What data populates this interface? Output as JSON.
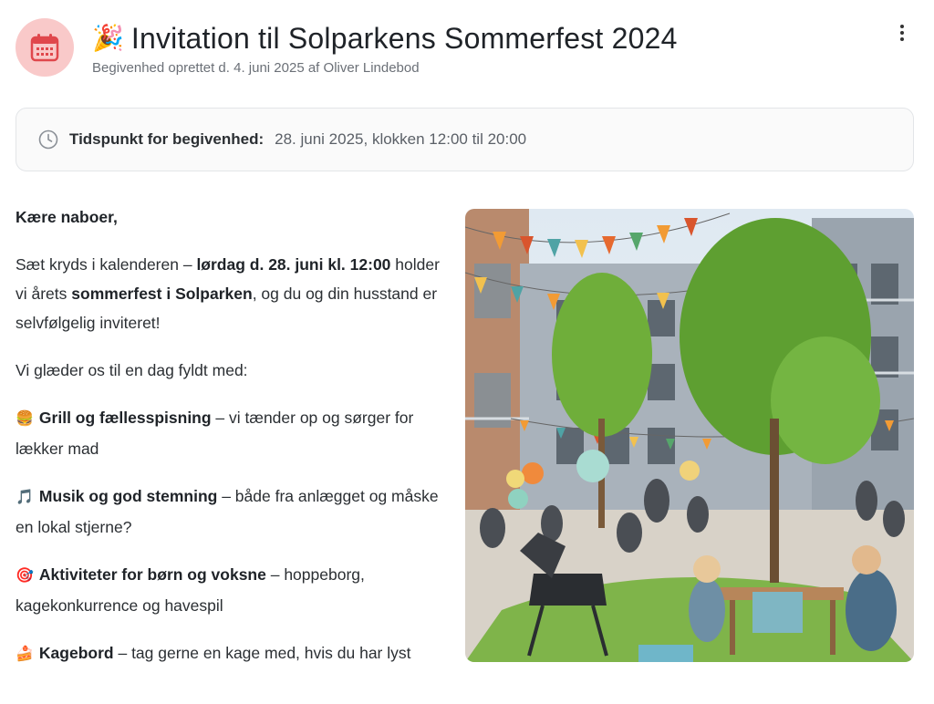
{
  "header": {
    "title_emoji": "🎉",
    "title": "Invitation til Solparkens Sommerfest 2024",
    "subtitle": "Begivenhed oprettet d. 4. juni 2025 af Oliver Lindebod",
    "icon": "calendar-icon",
    "menu_icon": "kebab-menu-icon"
  },
  "time": {
    "icon": "clock-icon",
    "label": "Tidspunkt for begivenhed:",
    "value": "28. juni 2025, klokken 12:00 til 20:00"
  },
  "body": {
    "greeting": "Kære naboer,",
    "p1_a": "Sæt kryds i kalenderen – ",
    "p1_b": "lørdag d. 28. juni kl. 12:00",
    "p1_c": " holder vi årets ",
    "p1_d": "sommerfest i Solparken",
    "p1_e": ", og du og din husstand er selvfølgelig inviteret!",
    "intro": "Vi glæder os til en dag fyldt med:",
    "items": [
      {
        "emoji": "🍔",
        "title": "Grill og fællesspisning",
        "text": " – vi tænder op og sørger for lækker mad"
      },
      {
        "emoji": "🎵",
        "title": "Musik og god stemning",
        "text": " – både fra anlægget og måske en lokal stjerne?"
      },
      {
        "emoji": "🎯",
        "title": "Aktiviteter for børn og voksne",
        "text": " – hoppeborg, kagekonkurrence og havespil"
      },
      {
        "emoji": "🍰",
        "title": "Kagebord",
        "text": " – tag gerne en kage med, hvis du har lyst"
      }
    ]
  },
  "colors": {
    "icon_bg": "#f9c9c9",
    "icon_red": "#e0474c"
  }
}
